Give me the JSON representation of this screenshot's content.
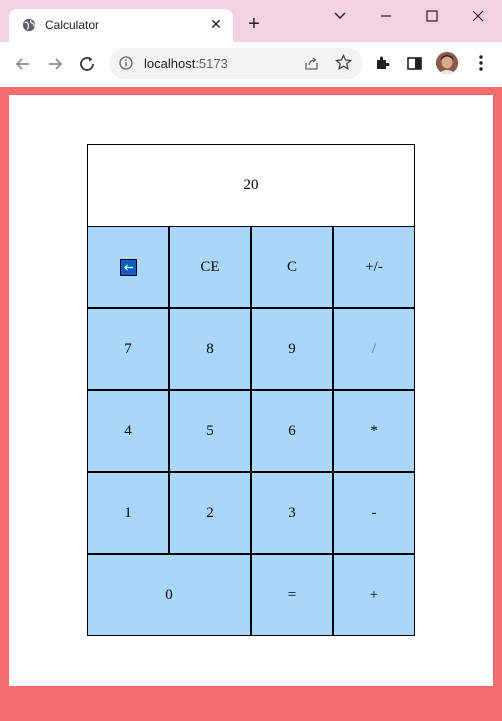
{
  "browser": {
    "tab_title": "Calculator",
    "url_host": "localhost",
    "url_port": ":5173"
  },
  "calculator": {
    "display": "20",
    "keys": {
      "ce": "CE",
      "c": "C",
      "negate": "+/-",
      "seven": "7",
      "eight": "8",
      "nine": "9",
      "divide": "/",
      "four": "4",
      "five": "5",
      "six": "6",
      "multiply": "*",
      "one": "1",
      "two": "2",
      "three": "3",
      "subtract": "-",
      "zero": "0",
      "equals": "=",
      "add": "+"
    }
  },
  "colors": {
    "page_background": "#f56e6e",
    "key_background": "#a9d7fb",
    "tabstrip": "#f3d3e3"
  }
}
